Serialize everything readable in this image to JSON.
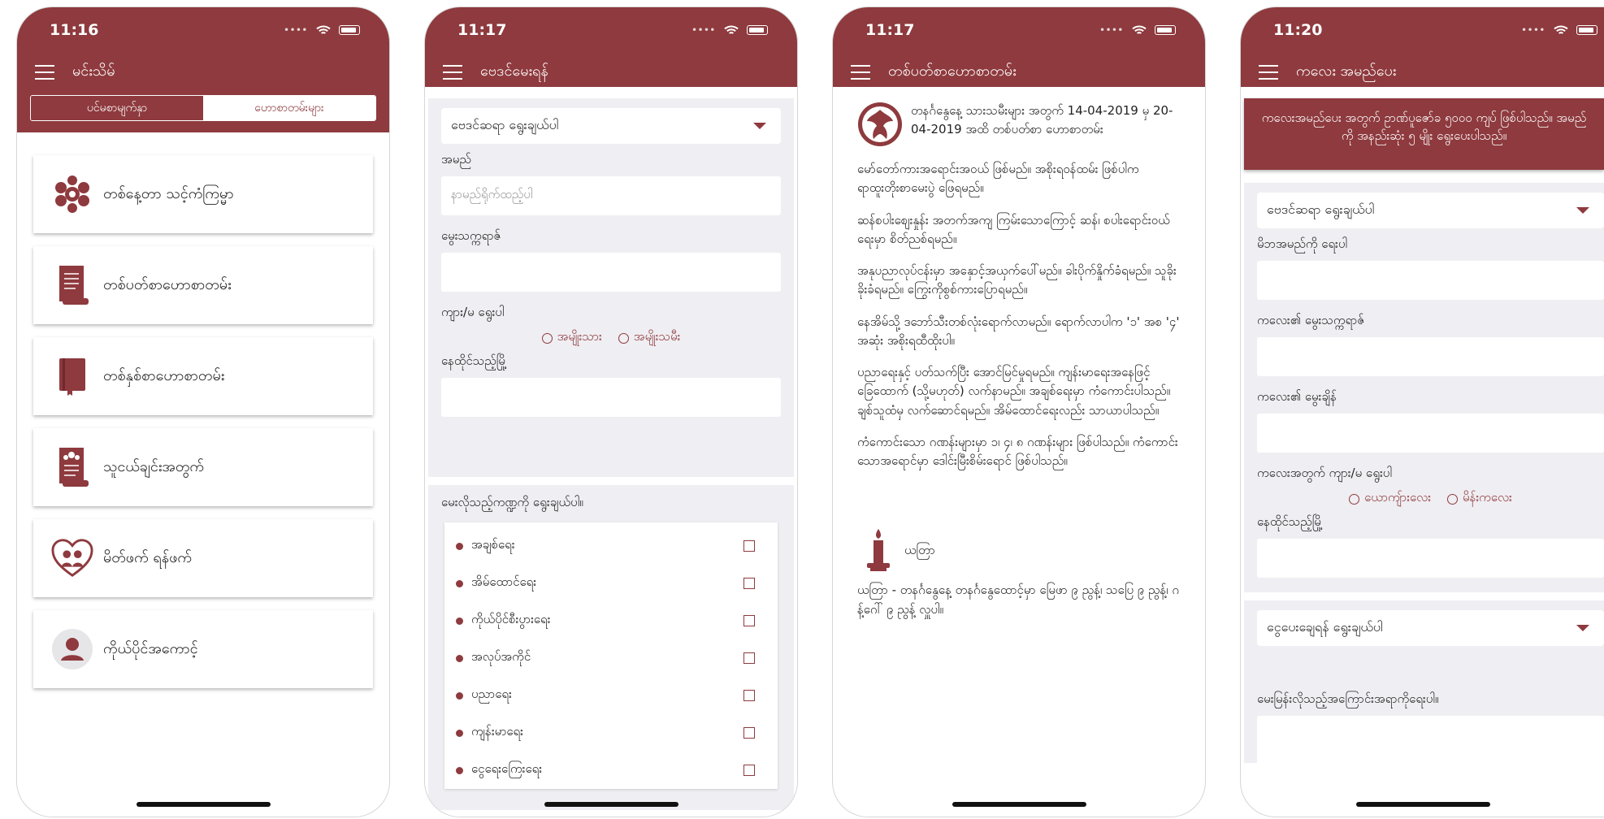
{
  "colors": {
    "brand": "#8e3a3e",
    "panel": "#efeef2"
  },
  "screens": [
    {
      "time": "11:16",
      "title": "မင်းသိမ်",
      "segments": [
        "ပင်မစာမျက်နှာ",
        "ဟောစာတမ်းများ"
      ],
      "menu": [
        {
          "icon": "horoscope-wheel-icon",
          "label": "တစ်နေ့တာ သင့်ကံကြမ္မာ"
        },
        {
          "icon": "scroll-icon",
          "label": "တစ်ပတ်စာဟောစာတမ်း"
        },
        {
          "icon": "book-icon",
          "label": "တစ်နှစ်စာဟောစာတမ်း"
        },
        {
          "icon": "group-scroll-icon",
          "label": "သူငယ်ချင်းအတွက်"
        },
        {
          "icon": "heart-couple-icon",
          "label": "မိတ်ဖက် ရန်ဖက်"
        },
        {
          "icon": "user-avatar-icon",
          "label": "ကိုယ်ပိုင်အကောင့်"
        }
      ]
    },
    {
      "time": "11:17",
      "title": "ဗေဒင်မေးရန်",
      "select_astrologer": "ဗေဒင်ဆရာ ရွေးချယ်ပါ",
      "name_label": "အမည်",
      "name_placeholder": "နာမည်ရိုက်ထည့်ပါ",
      "dob_label": "မွေးသက္ကရာဇ်",
      "gender_label": "ကျား/မ ရွေးပါ",
      "gender_options": [
        "အမျိုးသား",
        "အမျိုးသမီး"
      ],
      "city_label": "နေထိုင်သည့်မြို့",
      "topics_label": "မေးလိုသည့်ကဏ္ဍကို ရွေးချယ်ပါ။",
      "topics": [
        "အချစ်ရေး",
        "အိမ်ထောင်ရေး",
        "ကိုယ်ပိုင်စီးပွားရေး",
        "အလုပ်အကိုင်",
        "ပညာရေး",
        "ကျန်းမာရေး",
        "ငွေရေးကြေးရေး"
      ]
    },
    {
      "time": "11:17",
      "title": "တစ်ပတ်စာဟောစာတမ်း",
      "intro": "တနင်္ဂနွေနေ့ သားသမီးများ အတွက် 14-04-2019 မှ 20-04-2019 အထိ တစ်ပတ်စာ ဟောစာတမ်း",
      "paragraphs": [
        "မော်တော်ကားအရောင်းအဝယ် ဖြစ်မည်။ အစိုးရဝန်ထမ်း ဖြစ်ပါက ရာထူးတိုးစာမေးပွဲ ဖြေရမည်။",
        "ဆန်စပါးစျေးနှုန်း အတက်အကျ ကြမ်းသောကြောင့် ဆန်၊ စပါးရောင်းဝယ်ရေးမှာ စိတ်ညစ်ရမည်။",
        "အနုပညာလုပ်ငန်းမှာ အနှောင့်အယှက်ပေါ်မည်။ ခါးပိုက်နှိုက်ခံရမည်။ သူခိုးခိုးခံရမည်။ ကြွေးကိုစွစ်ကားပြောရမည်။",
        "နေအိမ်သို့ ဒဘော်သီးတစ်လုံးရောက်လာမည်။ ရောက်လာပါက '၁' အစ '၄' အဆုံး အစိုးရထီထိုးပါ။",
        "ပညာရေးနှင့် ပတ်သက်ပြီး အောင်မြင်မှုရမည်။ ကျန်းမာရေးအနေဖြင့် ခြေထောက် (သို့မဟုတ်) လက်နာမည်။ အချစ်ရေးမှာ ကံကောင်းပါသည်။ ချစ်သူထံမှ လက်ဆောင်ရမည်။ အိမ်ထောင်ရေးလည်း သာယာပါသည်။",
        "ကံကောင်းသော ဂဏန်းများမှာ ၁၊ ၄၊ ၈ ဂဏန်းများ ဖြစ်ပါသည်။ ကံကောင်းသောအရောင်မှာ ဒေါင်းမြီးစိမ်းရောင် ဖြစ်ပါသည်။"
      ],
      "yadaya_title": "ယတြာ",
      "yadaya_text": "ယတြာ - တနင်္ဂနွေနေ့ တနင်္ဂနွေထောင့်မှာ မြေဖာ ၉ ညွန့်၊ သပြေ ၉ ညွန့်၊ ဂန့်ဂေါ် ၉ ညွန့် လှူပါ။"
    },
    {
      "time": "11:20",
      "title": "ကလေး အမည်ပေး",
      "banner": "ကလေးအမည်ပေး အတွက် ဥာဏ်ပူဇော်ခ ၅၀၀၀ ကျပ် ဖြစ်ပါသည်။ အမည်ကို အနည်းဆုံး ၅ မျိုး ရွေးပေးပါသည်။",
      "select_astrologer": "ဗေဒင်ဆရာ ရွေးချယ်ပါ",
      "parent_label": "မိဘအမည်ကို ရေးပါ",
      "dob_label": "ကလေး၏ မွေးသက္ကရာဇ်",
      "time_label": "ကလေး၏ မွေးချိန်",
      "gender_label": "ကလေးအတွက် ကျား/မ ရွေးပါ",
      "gender_options": [
        "ယောကျ်ားလေး",
        "မိန်းကလေး"
      ],
      "city_label": "နေထိုင်သည့်မြို့",
      "payment_select": "ငွေပေးချေရန် ရွေးချယ်ပါ",
      "request_label": "မေးမြန်းလိုသည့်အကြောင်းအရာကိုရေးပါ။"
    }
  ]
}
